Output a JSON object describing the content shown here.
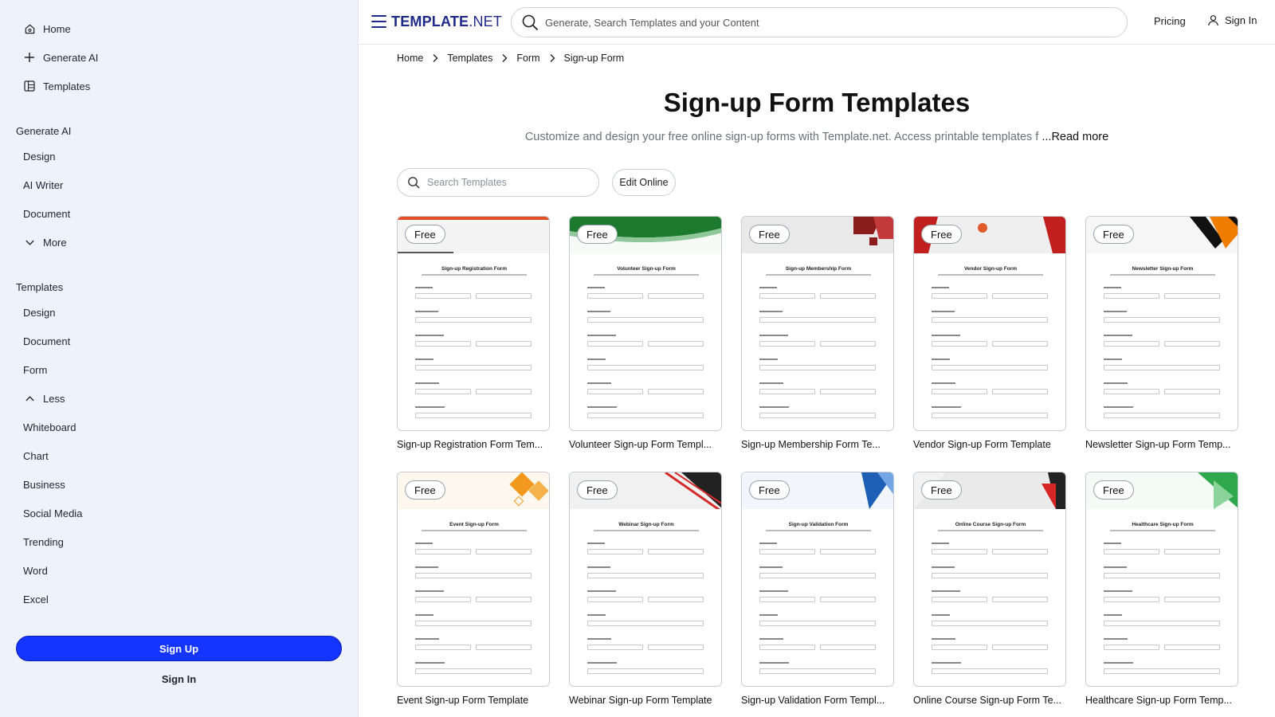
{
  "sidebar": {
    "top_items": [
      {
        "label": "Home",
        "icon": "home-icon"
      },
      {
        "label": "Generate AI",
        "icon": "plus-icon"
      },
      {
        "label": "Templates",
        "icon": "templates-icon"
      }
    ],
    "generate_heading": "Generate AI",
    "generate_items": [
      "Design",
      "AI Writer",
      "Document"
    ],
    "more_label": "More",
    "templates_heading": "Templates",
    "template_items_a": [
      "Design",
      "Document",
      "Form"
    ],
    "less_label": "Less",
    "template_items_b": [
      "Whiteboard",
      "Chart",
      "Business",
      "Social Media",
      "Trending",
      "Word",
      "Excel"
    ],
    "sign_up": "Sign Up",
    "sign_in": "Sign In"
  },
  "header": {
    "logo_main": "TEMPLATE",
    "logo_suffix": ".NET",
    "search_placeholder": "Generate, Search Templates and your Content",
    "pricing": "Pricing",
    "sign_in": "Sign In"
  },
  "breadcrumb": [
    "Home",
    "Templates",
    "Form",
    "Sign-up Form"
  ],
  "main": {
    "title": "Sign-up Form Templates",
    "subtitle": "Customize and design your free online sign-up forms with Template.net. Access printable templates f",
    "read_more": "...Read more",
    "search_placeholder": "Search Templates",
    "edit_online": "Edit Online",
    "badge": "Free"
  },
  "cards": [
    {
      "title": "Sign-up Registration Form Tem...",
      "form": "Sign-up Registration Form",
      "accent": "#e0502a"
    },
    {
      "title": "Volunteer Sign-up Form Templ...",
      "form": "Volunteer Sign-up Form",
      "accent": "#1b7a2e"
    },
    {
      "title": "Sign-up Membership Form Te...",
      "form": "Sign-up Membership Form",
      "accent": "#8a1c1c"
    },
    {
      "title": "Vendor Sign-up Form Template",
      "form": "Vendor Sign-up Form",
      "accent": "#c21f1f"
    },
    {
      "title": "Newsletter Sign-up Form Temp...",
      "form": "Newsletter Sign-up Form",
      "accent": "#f07c00"
    },
    {
      "title": "Event Sign-up Form Template",
      "form": "Event Sign-up Form",
      "accent": "#f39a1e"
    },
    {
      "title": "Webinar Sign-up Form Template",
      "form": "Webinar Sign-up Form",
      "accent": "#d42a2a"
    },
    {
      "title": "Sign-up Validation Form Templ...",
      "form": "Sign-up Validation Form",
      "accent": "#1d5fb5"
    },
    {
      "title": "Online Course Sign-up Form Te...",
      "form": "Online Course Sign-up Form",
      "accent": "#d62525"
    },
    {
      "title": "Healthcare Sign-up Form Temp...",
      "form": "Healthcare Sign-up Form",
      "accent": "#2ea84a"
    }
  ]
}
